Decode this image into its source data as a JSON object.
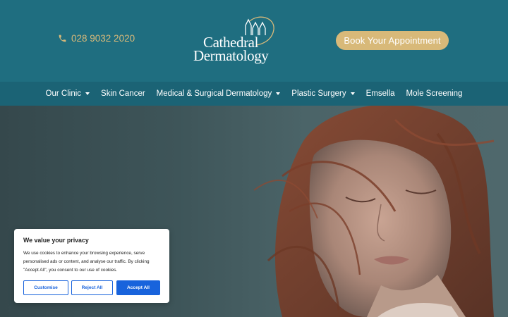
{
  "header": {
    "phone": "028 9032 2020",
    "logo_line1": "Cathedral",
    "logo_line2": "Dermatology",
    "book_button": "Book Your Appointment"
  },
  "nav": {
    "items": [
      {
        "label": "Our Clinic",
        "dropdown": true
      },
      {
        "label": "Skin Cancer",
        "dropdown": false
      },
      {
        "label": "Medical & Surgical Dermatology",
        "dropdown": true
      },
      {
        "label": "Plastic Surgery",
        "dropdown": true
      },
      {
        "label": "Emsella",
        "dropdown": false
      },
      {
        "label": "Mole Screening",
        "dropdown": false
      }
    ]
  },
  "hero": {
    "image": "woman-with-windswept-red-hair-photo"
  },
  "cookie": {
    "title": "We value your privacy",
    "body": "We use cookies to enhance your browsing experience, serve personalised ads or content, and analyse our traffic. By clicking \"Accept All\", you consent to our use of cookies.",
    "customise": "Customise",
    "reject": "Reject All",
    "accept": "Accept All"
  },
  "colors": {
    "header_bg": "#1f6e80",
    "nav_bg": "#1b6375",
    "gold": "#d8b979",
    "cookie_accent": "#1863dc"
  }
}
